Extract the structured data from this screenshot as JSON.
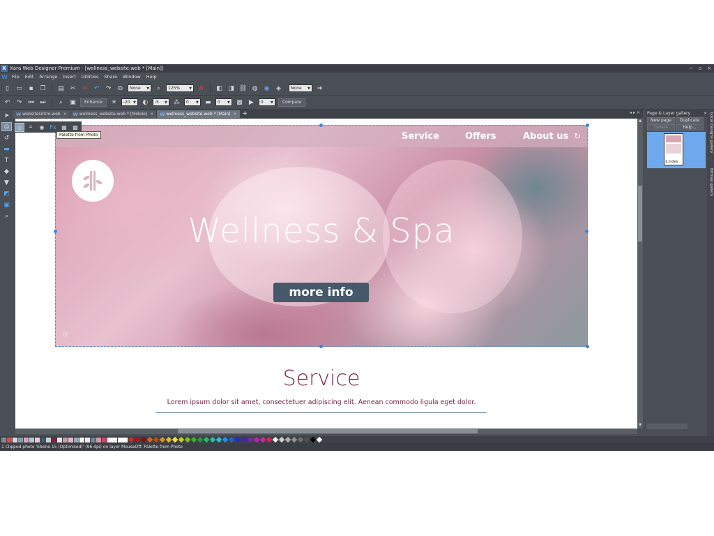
{
  "window": {
    "title": "Xara Web Designer Premium - [wellness_website.web * [Main]]",
    "controls": [
      "−",
      "▫",
      "×"
    ]
  },
  "menu": [
    "File",
    "Edit",
    "Arrange",
    "Insert",
    "Utilities",
    "Share",
    "Window",
    "Help"
  ],
  "toolbar1": {
    "quality_select": "None",
    "zoom_select": "125%",
    "feather_select": "None"
  },
  "toolbar2": {
    "enhance_label": "Enhance",
    "brightness_value": "-20",
    "contrast_value": "-5",
    "saturation_value": "0",
    "temperature_value": "0",
    "sharpen_value": "0",
    "compare_label": "Compare"
  },
  "tabs": [
    {
      "label": "websitesintro.web",
      "active": false
    },
    {
      "label": "wellness_website.web * [Mobile]",
      "active": false
    },
    {
      "label": "wellness_website.web * [Main]",
      "active": true
    }
  ],
  "tooltip": "Palette from Photo",
  "site": {
    "nav": [
      "Service",
      "Offers",
      "About us"
    ],
    "hero_title": "Wellness & Spa",
    "more_button": "more info",
    "service_title": "Service",
    "service_text": "Lorem ipsum dolor sit amet, consectetuer adipiscing elit. Aenean commodo ligula eget dolor."
  },
  "gallery": {
    "title": "Page & Layer gallery",
    "buttons": [
      "New page",
      "Duplicate",
      "Delete",
      "Help..."
    ],
    "page_label": "1:index"
  },
  "side_tabs": [
    "Local Designs gallery",
    "Bitmap gallery"
  ],
  "status": "1 Clipped photo 'Ebene 15 (Optimised)' (96 dpi) on layer MouseOff: Palette from Photo",
  "colors": {
    "accent": "#3c82e0",
    "service_text": "#7a2440",
    "button": "#46596b"
  }
}
